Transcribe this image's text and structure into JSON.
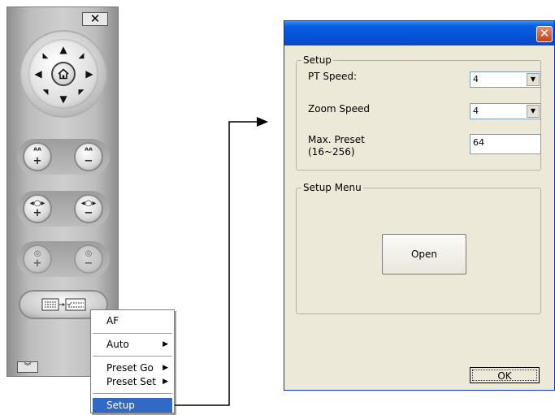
{
  "ptz_panel": {
    "close_glyph": "✕",
    "collapse_glyph": "︾",
    "arrows": {
      "up": "▲",
      "down": "▼",
      "left": "◀",
      "right": "▶",
      "up_left": "◣",
      "up_right": "◢",
      "down_left": "◥",
      "down_right": "◤"
    },
    "zoom_plus_sign": "+",
    "zoom_minus_sign": "−",
    "icons": [
      "close-icon",
      "home-icon",
      "zoom-in-icon",
      "zoom-out-icon",
      "focus-far-icon",
      "focus-near-icon",
      "iris-open-icon",
      "iris-close-icon",
      "setup-menu-icon",
      "collapse-icon"
    ]
  },
  "context_menu": {
    "items": [
      {
        "label": "AF",
        "has_submenu": false
      },
      {
        "label": "Auto",
        "has_submenu": true
      },
      {
        "label": "Preset Go",
        "has_submenu": true
      },
      {
        "label": "Preset Set",
        "has_submenu": true
      },
      {
        "label": "Setup",
        "has_submenu": false,
        "selected": true
      }
    ],
    "submenu_glyph": "▶",
    "highlight_color": "#316ac5"
  },
  "setup_dialog": {
    "close_glyph": "✕",
    "setup_group": {
      "legend": "Setup",
      "pt_speed_label": "PT Speed:",
      "pt_speed_value": "4",
      "zoom_speed_label": "Zoom Speed",
      "zoom_speed_value": "4",
      "max_preset_label_line1": "Max. Preset",
      "max_preset_label_line2": "(16~256)",
      "max_preset_value": "64"
    },
    "setup_menu_group": {
      "legend": "Setup Menu",
      "open_button": "Open"
    },
    "ok_button": "OK",
    "dropdown_glyph": "▼",
    "title_bar_color": "#0553d9",
    "close_button_color": "#c6411e"
  }
}
